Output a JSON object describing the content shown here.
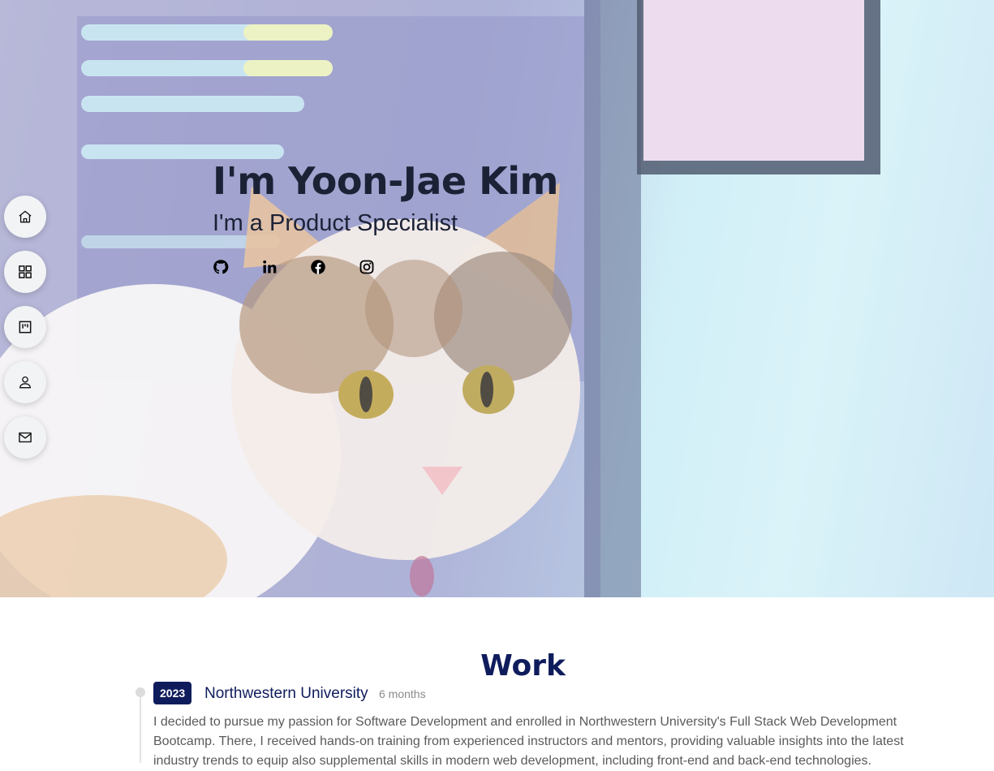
{
  "hero": {
    "title": "I'm Yoon-Jae Kim",
    "subtitle": "I'm a Product Specialist"
  },
  "social_links": [
    {
      "icon": "github-icon"
    },
    {
      "icon": "linkedin-icon"
    },
    {
      "icon": "facebook-icon"
    },
    {
      "icon": "instagram-icon"
    }
  ],
  "side_nav": [
    {
      "icon": "home-icon"
    },
    {
      "icon": "grid-icon"
    },
    {
      "icon": "board-icon"
    },
    {
      "icon": "user-icon"
    },
    {
      "icon": "mail-icon"
    }
  ],
  "work": {
    "title": "Work",
    "entries": [
      {
        "year": "2023",
        "organization": "Northwestern University",
        "duration": "6 months",
        "description": "I decided to pursue my passion for Software Development and enrolled in Northwestern University's Full Stack Web Development Bootcamp. There, I received hands-on training from experienced instructors and mentors, providing valuable insights into the latest industry trends to equip also supplemental skills in modern web development, including front-end and back-end technologies."
      }
    ]
  },
  "colors": {
    "accent": "#0f1c5c",
    "text_dark": "#1c2236",
    "muted": "#8a8a8a"
  }
}
